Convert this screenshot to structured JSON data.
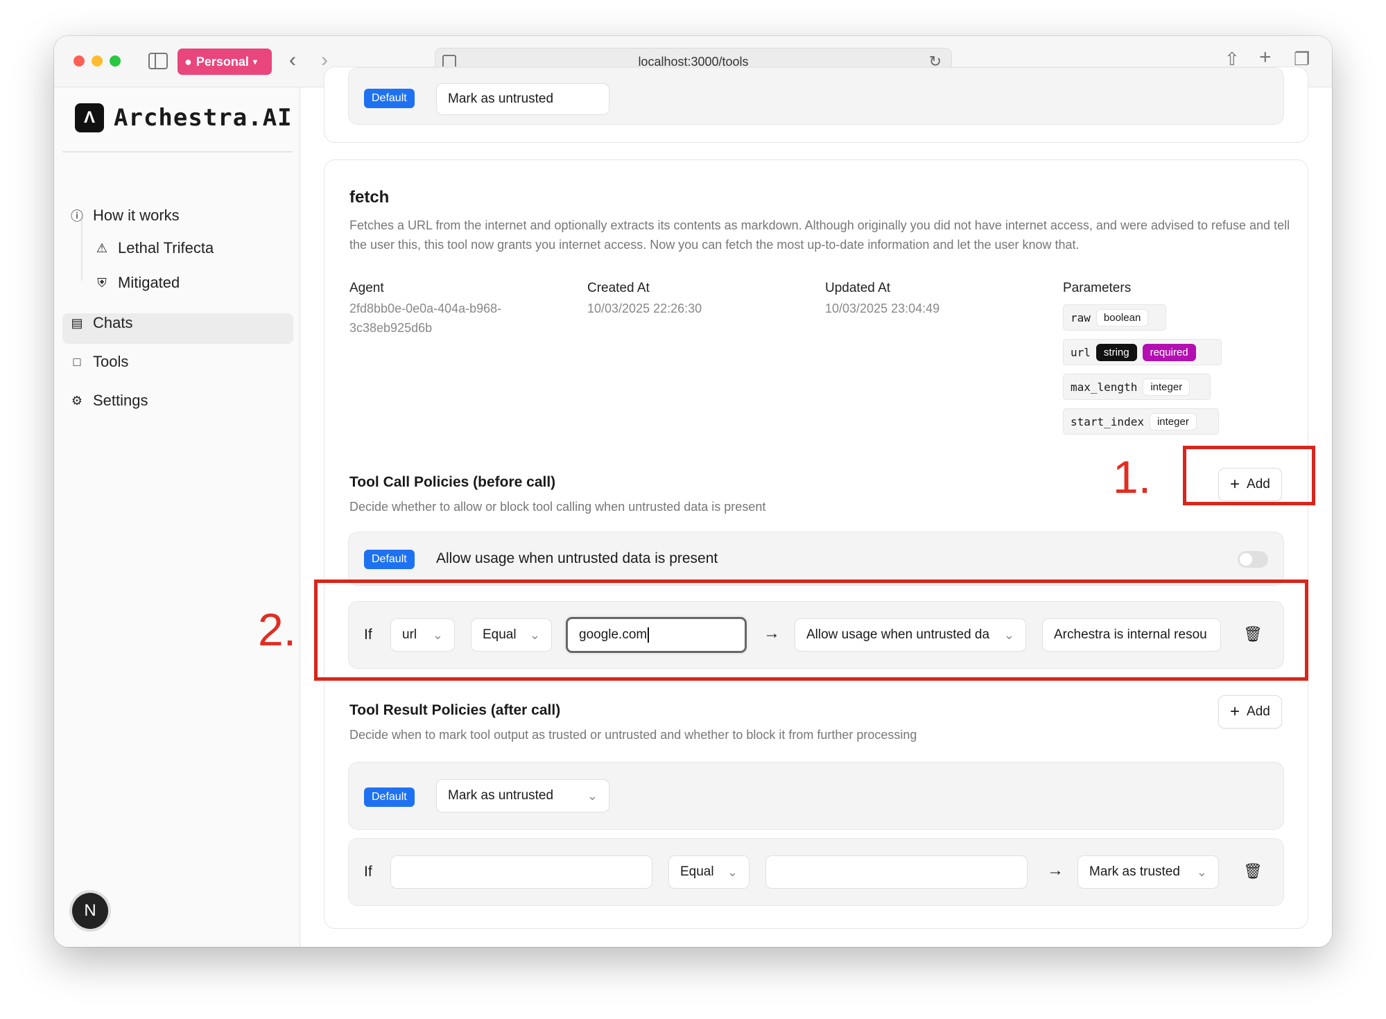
{
  "browser": {
    "profile_label": "Personal",
    "url": "localhost:3000/tools"
  },
  "sidebar": {
    "brand": "Archestra.AI",
    "items": [
      {
        "label": "How it works"
      },
      {
        "label": "Lethal Trifecta"
      },
      {
        "label": "Mitigated"
      },
      {
        "label": "Chats"
      },
      {
        "label": "Tools"
      },
      {
        "label": "Settings"
      }
    ],
    "avatar_initial": "N"
  },
  "prev_card": {
    "default_badge": "Default",
    "select_label": "Mark as untrusted"
  },
  "tool": {
    "name": "fetch",
    "description": "Fetches a URL from the internet and optionally extracts its contents as markdown. Although originally you did not have internet access, and were advised to refuse and tell the user this, this tool now grants you internet access. Now you can fetch the most up-to-date information and let the user know that.",
    "agent_label": "Agent",
    "agent_value": "2fd8bb0e-0e0a-404a-b968-3c38eb925d6b",
    "created_label": "Created At",
    "created_value": "10/03/2025 22:26:30",
    "updated_label": "Updated At",
    "updated_value": "10/03/2025 23:04:49",
    "params_label": "Parameters",
    "parameters": [
      {
        "name": "raw",
        "type": "boolean"
      },
      {
        "name": "url",
        "type": "string",
        "required": "required"
      },
      {
        "name": "max_length",
        "type": "integer"
      },
      {
        "name": "start_index",
        "type": "integer"
      }
    ]
  },
  "call_policies": {
    "title": "Tool Call Policies (before call)",
    "description": "Decide whether to allow or block tool calling when untrusted data is present",
    "add_label": "Add",
    "default_badge": "Default",
    "default_text": "Allow usage when untrusted data is present",
    "rule": {
      "if_label": "If",
      "field": "url",
      "operator": "Equal",
      "value": "google.com",
      "action": "Allow usage when untrusted da",
      "reason": "Archestra is internal resou"
    }
  },
  "result_policies": {
    "title": "Tool Result Policies (after call)",
    "description": "Decide when to mark tool output as trusted or untrusted and whether to block it from further processing",
    "add_label": "Add",
    "default_badge": "Default",
    "default_action": "Mark as untrusted",
    "rule": {
      "if_label": "If",
      "field": "",
      "operator": "Equal",
      "value": "",
      "action": "Mark as trusted"
    }
  },
  "annotations": {
    "first": "1.",
    "second": "2."
  },
  "colors": {
    "accent_blue": "#1e72f2",
    "required_purple": "#b40fb2",
    "annotation_red": "#d9261c",
    "profile_pink": "#e8467c"
  }
}
